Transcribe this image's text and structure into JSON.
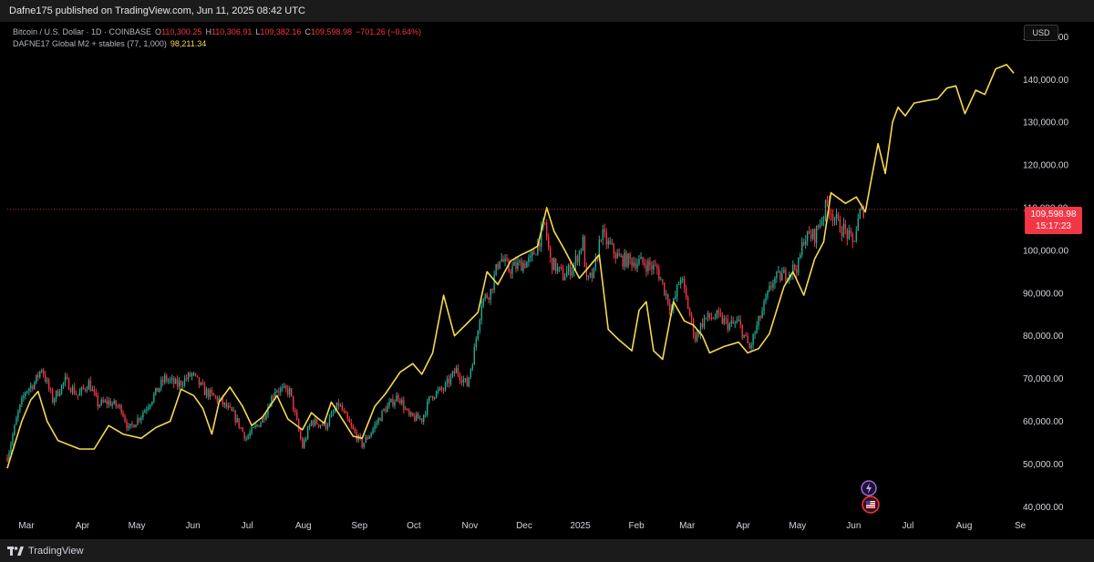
{
  "header": {
    "published": "Dafne175 published on TradingView.com, Jun 11, 2025 08:42 UTC"
  },
  "legend": {
    "symbol": "Bitcoin / U.S. Dollar · 1D · COINBASE",
    "o_label": "O",
    "o_value": "110,300.25",
    "h_label": "H",
    "h_value": "110,306.91",
    "l_label": "L",
    "l_value": "109,382.16",
    "c_label": "C",
    "c_value": "109,598.98",
    "change": "−701.26 (−0.64%)",
    "indicator": "DAFNE17 Global M2 + stables (77, 1,000)",
    "indicator_value": "98,211.34"
  },
  "currency": "USD",
  "last_price": {
    "price": "109,598.98",
    "countdown": "15:17:23"
  },
  "footer": {
    "brand": "TradingView"
  },
  "colors": {
    "up": "#22ab94",
    "down": "#f23645",
    "m2": "#f7d94c",
    "background": "#000000"
  },
  "chart_data": {
    "type": "line",
    "subtype": "candlestick with overlay line",
    "y_ticks": [
      40000,
      50000,
      60000,
      70000,
      80000,
      90000,
      100000,
      110000,
      120000,
      130000,
      140000,
      150000
    ],
    "y_tick_labels": [
      "40,000.00",
      "50,000.00",
      "60,000.00",
      "70,000.00",
      "80,000.00",
      "90,000.00",
      "100,000.00",
      "110,000.00",
      "120,000.00",
      "130,000.00",
      "140,000.00",
      "150,000.00"
    ],
    "ylim": [
      37500,
      153500
    ],
    "x_labels": [
      "Mar",
      "Apr",
      "May",
      "Jun",
      "Jul",
      "Aug",
      "Sep",
      "Oct",
      "Nov",
      "Dec",
      "2025",
      "Feb",
      "Mar",
      "Apr",
      "May",
      "Jun",
      "Jul",
      "Aug",
      "Se"
    ],
    "x_label_dates": [
      "2024-03-01",
      "2024-04-01",
      "2024-05-01",
      "2024-06-01",
      "2024-07-01",
      "2024-08-01",
      "2024-09-01",
      "2024-10-01",
      "2024-11-01",
      "2024-12-01",
      "2025-01-01",
      "2025-02-01",
      "2025-03-01",
      "2025-04-01",
      "2025-05-01",
      "2025-06-01",
      "2025-07-01",
      "2025-08-01",
      "2025-09-01"
    ],
    "xlim": [
      "2024-02-24",
      "2025-09-05"
    ],
    "last_close": 109598.98,
    "series": [
      {
        "name": "Bitcoin / U.S. Dollar",
        "kind": "candlestick",
        "points": [
          [
            "2024-02-24",
            51500
          ],
          [
            "2024-03-01",
            62000
          ],
          [
            "2024-03-05",
            67000
          ],
          [
            "2024-03-10",
            69000
          ],
          [
            "2024-03-14",
            72500
          ],
          [
            "2024-03-20",
            65000
          ],
          [
            "2024-03-27",
            69500
          ],
          [
            "2024-04-03",
            66000
          ],
          [
            "2024-04-09",
            69000
          ],
          [
            "2024-04-14",
            64000
          ],
          [
            "2024-04-20",
            64500
          ],
          [
            "2024-04-27",
            63000
          ],
          [
            "2024-05-01",
            58000
          ],
          [
            "2024-05-08",
            61500
          ],
          [
            "2024-05-15",
            66000
          ],
          [
            "2024-05-21",
            70000
          ],
          [
            "2024-05-28",
            68500
          ],
          [
            "2024-06-05",
            71000
          ],
          [
            "2024-06-12",
            67000
          ],
          [
            "2024-06-20",
            65000
          ],
          [
            "2024-06-28",
            61500
          ],
          [
            "2024-07-05",
            56000
          ],
          [
            "2024-07-14",
            60500
          ],
          [
            "2024-07-21",
            67500
          ],
          [
            "2024-07-29",
            67000
          ],
          [
            "2024-08-05",
            54000
          ],
          [
            "2024-08-10",
            60000
          ],
          [
            "2024-08-18",
            59000
          ],
          [
            "2024-08-25",
            64000
          ],
          [
            "2024-09-01",
            58500
          ],
          [
            "2024-09-07",
            54500
          ],
          [
            "2024-09-12",
            57500
          ],
          [
            "2024-09-19",
            62500
          ],
          [
            "2024-09-27",
            66000
          ],
          [
            "2024-10-03",
            61000
          ],
          [
            "2024-10-10",
            60500
          ],
          [
            "2024-10-15",
            66000
          ],
          [
            "2024-10-22",
            67500
          ],
          [
            "2024-10-29",
            72000
          ],
          [
            "2024-11-04",
            68500
          ],
          [
            "2024-11-08",
            76500
          ],
          [
            "2024-11-12",
            88000
          ],
          [
            "2024-11-17",
            90500
          ],
          [
            "2024-11-22",
            98500
          ],
          [
            "2024-11-27",
            95500
          ],
          [
            "2024-12-05",
            97000
          ],
          [
            "2024-12-09",
            97500
          ],
          [
            "2024-12-13",
            101500
          ],
          [
            "2024-12-17",
            106000
          ],
          [
            "2024-12-20",
            97500
          ],
          [
            "2024-12-27",
            94000
          ],
          [
            "2025-01-02",
            96500
          ],
          [
            "2025-01-07",
            102000
          ],
          [
            "2025-01-09",
            92500
          ],
          [
            "2025-01-13",
            94500
          ],
          [
            "2025-01-17",
            104000
          ],
          [
            "2025-01-20",
            102000
          ],
          [
            "2025-01-27",
            98000
          ],
          [
            "2025-02-03",
            97500
          ],
          [
            "2025-02-10",
            97000
          ],
          [
            "2025-02-17",
            95500
          ],
          [
            "2025-02-25",
            86000
          ],
          [
            "2025-03-02",
            94000
          ],
          [
            "2025-03-10",
            79500
          ],
          [
            "2025-03-15",
            84000
          ],
          [
            "2025-03-22",
            84500
          ],
          [
            "2025-03-29",
            82500
          ],
          [
            "2025-04-03",
            83000
          ],
          [
            "2025-04-09",
            77000
          ],
          [
            "2025-04-15",
            84500
          ],
          [
            "2025-04-22",
            93000
          ],
          [
            "2025-04-29",
            94500
          ],
          [
            "2025-05-06",
            96500
          ],
          [
            "2025-05-09",
            103000
          ],
          [
            "2025-05-15",
            103500
          ],
          [
            "2025-05-22",
            111000
          ],
          [
            "2025-05-28",
            106000
          ],
          [
            "2025-06-01",
            104500
          ],
          [
            "2025-06-05",
            101500
          ],
          [
            "2025-06-09",
            108500
          ],
          [
            "2025-06-11",
            109598.98
          ]
        ]
      },
      {
        "name": "DAFNE17 Global M2 + stables (77, 1,000)",
        "kind": "line",
        "points": [
          [
            "2024-02-24",
            49000
          ],
          [
            "2024-03-03",
            60000
          ],
          [
            "2024-03-08",
            65000
          ],
          [
            "2024-03-12",
            67000
          ],
          [
            "2024-03-17",
            60000
          ],
          [
            "2024-03-23",
            55500
          ],
          [
            "2024-04-04",
            53500
          ],
          [
            "2024-04-12",
            53500
          ],
          [
            "2024-04-20",
            59000
          ],
          [
            "2024-04-28",
            57000
          ],
          [
            "2024-05-08",
            56000
          ],
          [
            "2024-05-16",
            58500
          ],
          [
            "2024-05-24",
            60000
          ],
          [
            "2024-05-30",
            67500
          ],
          [
            "2024-06-06",
            66000
          ],
          [
            "2024-06-11",
            63000
          ],
          [
            "2024-06-16",
            57000
          ],
          [
            "2024-06-20",
            64500
          ],
          [
            "2024-06-26",
            68000
          ],
          [
            "2024-07-03",
            63500
          ],
          [
            "2024-07-08",
            59000
          ],
          [
            "2024-07-14",
            61000
          ],
          [
            "2024-07-22",
            66000
          ],
          [
            "2024-07-28",
            60500
          ],
          [
            "2024-08-05",
            58000
          ],
          [
            "2024-08-10",
            62000
          ],
          [
            "2024-08-17",
            59500
          ],
          [
            "2024-08-21",
            64500
          ],
          [
            "2024-08-27",
            60500
          ],
          [
            "2024-09-02",
            56500
          ],
          [
            "2024-09-07",
            56000
          ],
          [
            "2024-09-14",
            63500
          ],
          [
            "2024-09-20",
            66500
          ],
          [
            "2024-09-28",
            71500
          ],
          [
            "2024-10-05",
            73500
          ],
          [
            "2024-10-10",
            71000
          ],
          [
            "2024-10-16",
            76000
          ],
          [
            "2024-10-22",
            89500
          ],
          [
            "2024-10-28",
            80000
          ],
          [
            "2024-11-03",
            82500
          ],
          [
            "2024-11-10",
            85500
          ],
          [
            "2024-11-15",
            95000
          ],
          [
            "2024-11-21",
            92000
          ],
          [
            "2024-11-28",
            97500
          ],
          [
            "2024-12-04",
            99000
          ],
          [
            "2024-12-09",
            100000
          ],
          [
            "2024-12-13",
            101000
          ],
          [
            "2024-12-18",
            110000
          ],
          [
            "2024-12-22",
            104500
          ],
          [
            "2024-12-28",
            100000
          ],
          [
            "2025-01-05",
            93500
          ],
          [
            "2025-01-11",
            96500
          ],
          [
            "2025-01-16",
            99000
          ],
          [
            "2025-01-21",
            81500
          ],
          [
            "2025-01-27",
            79000
          ],
          [
            "2025-02-03",
            76500
          ],
          [
            "2025-02-07",
            86000
          ],
          [
            "2025-02-11",
            88000
          ],
          [
            "2025-02-15",
            76500
          ],
          [
            "2025-02-20",
            74500
          ],
          [
            "2025-02-26",
            88000
          ],
          [
            "2025-03-04",
            83500
          ],
          [
            "2025-03-09",
            82500
          ],
          [
            "2025-03-14",
            80000
          ],
          [
            "2025-03-18",
            76000
          ],
          [
            "2025-03-26",
            77500
          ],
          [
            "2025-04-03",
            78500
          ],
          [
            "2025-04-08",
            76000
          ],
          [
            "2025-04-14",
            77000
          ],
          [
            "2025-04-20",
            80500
          ],
          [
            "2025-04-24",
            86000
          ],
          [
            "2025-04-28",
            91500
          ],
          [
            "2025-05-03",
            95000
          ],
          [
            "2025-05-09",
            89500
          ],
          [
            "2025-05-15",
            98000
          ],
          [
            "2025-05-20",
            102000
          ],
          [
            "2025-05-24",
            113500
          ],
          [
            "2025-06-01",
            111000
          ],
          [
            "2025-06-07",
            112500
          ],
          [
            "2025-06-12",
            109000
          ],
          [
            "2025-06-15",
            116000
          ],
          [
            "2025-06-19",
            125000
          ],
          [
            "2025-06-23",
            118000
          ],
          [
            "2025-06-27",
            130000
          ],
          [
            "2025-06-30",
            133500
          ],
          [
            "2025-07-04",
            131500
          ],
          [
            "2025-07-09",
            134500
          ],
          [
            "2025-07-15",
            135000
          ],
          [
            "2025-07-22",
            135500
          ],
          [
            "2025-07-27",
            138000
          ],
          [
            "2025-08-01",
            138500
          ],
          [
            "2025-08-06",
            132000
          ],
          [
            "2025-08-12",
            137500
          ],
          [
            "2025-08-17",
            136500
          ],
          [
            "2025-08-23",
            142500
          ],
          [
            "2025-08-29",
            143500
          ],
          [
            "2025-09-02",
            141500
          ]
        ]
      }
    ]
  }
}
